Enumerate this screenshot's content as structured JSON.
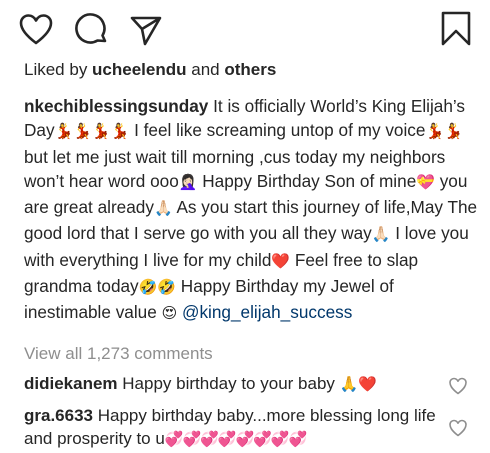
{
  "actions": {
    "like_icon": "heart-outline-icon",
    "comment_icon": "speech-bubble-icon",
    "share_icon": "paper-plane-icon",
    "save_icon": "bookmark-icon"
  },
  "likes": {
    "prefix": "Liked by ",
    "user": "ucheelendu",
    "middle": " and ",
    "others": "others"
  },
  "caption": {
    "username": "nkechiblessingsunday",
    "part1": " It is officially World’s King Elijah’s Day",
    "emoji1": "💃💃💃💃",
    "part2": " I feel like screaming untop of my voice",
    "emoji2": "💃💃",
    "part3": " but let me just wait till morning ,cus today my neighbors won’t hear word ooo",
    "emoji3": "🤦🏻‍♀️",
    "part4": " Happy Birthday Son of mine",
    "emoji4": "💝",
    "part5": " you are great already",
    "emoji5": "🙏🏻",
    "part6": " As you start this journey of life,May The good lord that I serve go with you all they way",
    "emoji6": "🙏🏻",
    "part7": " I love you with everything I live for my child",
    "emoji7": "❤️",
    "part8": " Feel free to slap grandma today",
    "emoji8": "🤣🤣",
    "part9": " Happy Birthday my Jewel of inestimable value ",
    "emoji9": "😍",
    "mention": "@king_elijah_success"
  },
  "view_all": "View all 1,273 comments",
  "comments": [
    {
      "username": "didiekanem",
      "text": " Happy birthday to your baby ",
      "emoji": "🙏❤️"
    },
    {
      "username": "gra.6633",
      "text": " Happy birthday baby...more blessing long life and prosperity to u",
      "emoji": "💞💞💞💞💞💞💞💞"
    }
  ],
  "colors": {
    "text": "#262626",
    "secondary": "#8e8e8e",
    "mention": "#00376b"
  }
}
